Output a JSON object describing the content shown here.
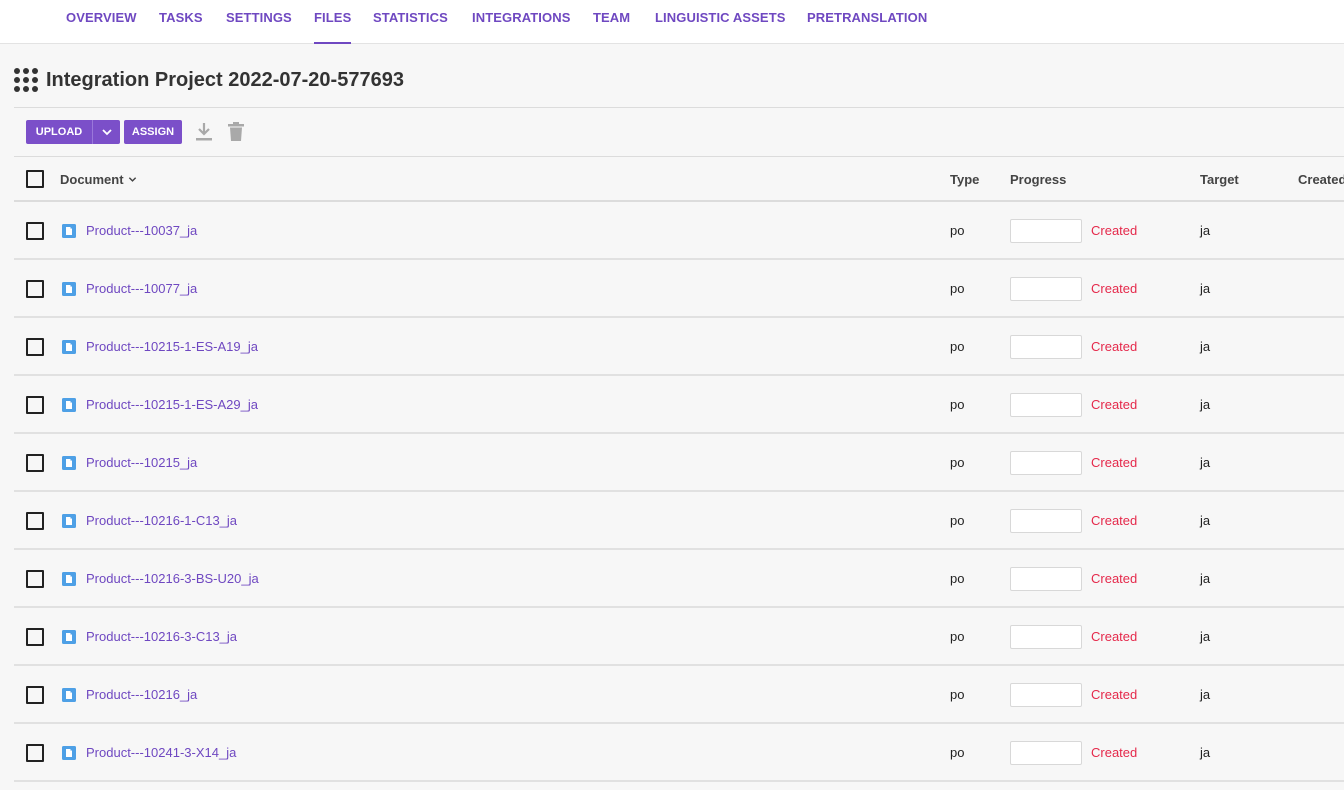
{
  "tabs": [
    {
      "label": "OVERVIEW",
      "active": false
    },
    {
      "label": "TASKS",
      "active": false
    },
    {
      "label": "SETTINGS",
      "active": false
    },
    {
      "label": "FILES",
      "active": true
    },
    {
      "label": "STATISTICS",
      "active": false
    },
    {
      "label": "INTEGRATIONS",
      "active": false
    },
    {
      "label": "TEAM",
      "active": false
    },
    {
      "label": "LINGUISTIC ASSETS",
      "active": false
    },
    {
      "label": "PRETRANSLATION",
      "active": false
    }
  ],
  "project": {
    "title": "Integration Project 2022-07-20-577693",
    "icon": "grid-apps-icon"
  },
  "toolbar": {
    "upload_label": "UPLOAD",
    "assign_label": "ASSIGN",
    "icons": [
      "chevron-down-icon",
      "download-icon",
      "trash-icon"
    ]
  },
  "table": {
    "columns": {
      "document": "Document",
      "type": "Type",
      "progress": "Progress",
      "target": "Target",
      "created": "Created"
    },
    "rows": [
      {
        "name": "Product---10037_ja",
        "type": "po",
        "status": "Created",
        "target": "ja"
      },
      {
        "name": "Product---10077_ja",
        "type": "po",
        "status": "Created",
        "target": "ja"
      },
      {
        "name": "Product---10215-1-ES-A19_ja",
        "type": "po",
        "status": "Created",
        "target": "ja"
      },
      {
        "name": "Product---10215-1-ES-A29_ja",
        "type": "po",
        "status": "Created",
        "target": "ja"
      },
      {
        "name": "Product---10215_ja",
        "type": "po",
        "status": "Created",
        "target": "ja"
      },
      {
        "name": "Product---10216-1-C13_ja",
        "type": "po",
        "status": "Created",
        "target": "ja"
      },
      {
        "name": "Product---10216-3-BS-U20_ja",
        "type": "po",
        "status": "Created",
        "target": "ja"
      },
      {
        "name": "Product---10216-3-C13_ja",
        "type": "po",
        "status": "Created",
        "target": "ja"
      },
      {
        "name": "Product---10216_ja",
        "type": "po",
        "status": "Created",
        "target": "ja"
      },
      {
        "name": "Product---10241-3-X14_ja",
        "type": "po",
        "status": "Created",
        "target": "ja"
      }
    ]
  },
  "colors": {
    "accent": "#6f48c1",
    "button": "#7b4fc9",
    "status_created": "#e5294b",
    "file_icon": "#4ea0e6"
  }
}
